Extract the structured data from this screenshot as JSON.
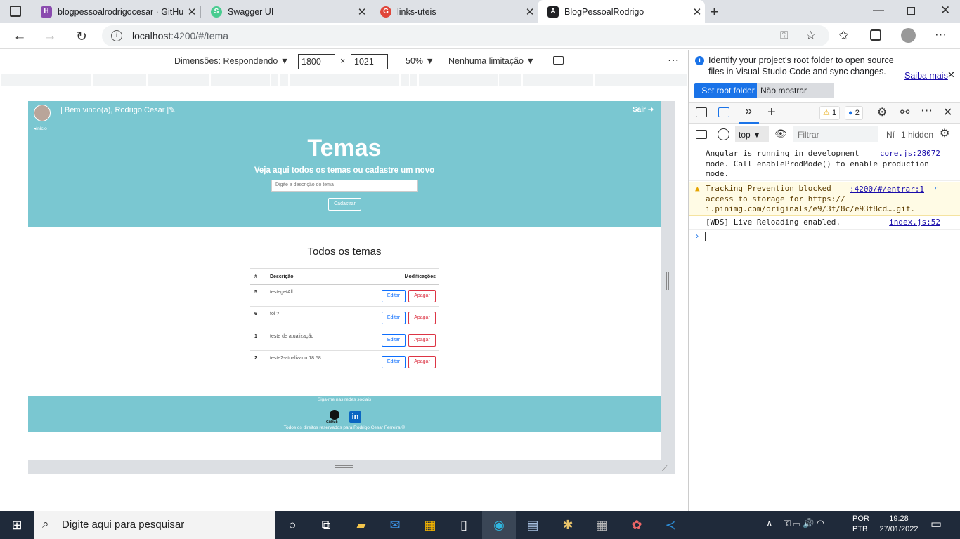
{
  "browser": {
    "tabs": [
      {
        "label": "blogpessoalrodrigocesar · GitHub",
        "icon": "H",
        "color": "#8a4baf",
        "active": false
      },
      {
        "label": "Swagger UI",
        "icon": "S",
        "color": "#49cc90",
        "active": false
      },
      {
        "label": "links-uteis",
        "icon": "G",
        "color": "#e0463a",
        "active": false
      },
      {
        "label": "BlogPessoalRodrigo",
        "icon": "A",
        "color": "#202124",
        "active": true
      }
    ],
    "url_host": "localhost",
    "url_path": ":4200/#/tema"
  },
  "devbar": {
    "dimensions": "Dimensões: Respondendo",
    "width": "1800",
    "height": "1021",
    "x": "×",
    "zoom": "50%",
    "throttle": "Nenhuma limitação"
  },
  "site": {
    "welcome": "| Bem vindo(a), Rodrigo Cesar |",
    "logout": "Sair",
    "home": "Início",
    "title": "Temas",
    "subtitle": "Veja aqui todos os temas ou cadastre um novo",
    "input_placeholder": "Digite a descrição do tema",
    "register_button": "Cadastrar",
    "list_title": "Todos os temas",
    "table": {
      "headers": {
        "num": "#",
        "desc": "Descrição",
        "mods": "Modificações"
      },
      "rows": [
        {
          "id": "5",
          "desc": "testegetAll"
        },
        {
          "id": "6",
          "desc": "foi ?"
        },
        {
          "id": "1",
          "desc": "teste de atualização"
        },
        {
          "id": "2",
          "desc": "teste2-atualizado 18:58"
        }
      ],
      "edit_label": "Editar",
      "delete_label": "Apagar"
    },
    "footer": {
      "follow": "Siga-me nas redes sociais",
      "github_label": "GitHub",
      "linkedin_label": "in",
      "copyright": "Todos os direitos reservados para Rodrigo Cesar Ferreira ©"
    }
  },
  "devtools": {
    "info_line1": "Identify your project's root folder to open source",
    "info_line2": "files in Visual Studio Code and sync changes.",
    "learn_more": "Saiba mais",
    "set_root": "Set root folder",
    "dont_show": "Não mostrar novamente",
    "warn_count": "1",
    "msg_count": "2",
    "context": "top",
    "filter_placeholder": "Filtrar",
    "levels": "Ní",
    "hidden": "1 hidden",
    "console": [
      {
        "lines": [
          "Angular is running in development",
          "mode. Call enableProdMode() to enable production",
          "mode."
        ],
        "source": "core.js:28072",
        "level": "info"
      },
      {
        "lines": [
          "Tracking Prevention blocked",
          "access to storage for https://",
          "i.pinimg.com/originals/e9/3f/8c/e93f8cd….gif."
        ],
        "source": ":4200/#/entrar:1",
        "level": "warning"
      },
      {
        "lines": [
          "[WDS] Live Reloading enabled."
        ],
        "source": "index.js:52",
        "level": "info"
      }
    ]
  },
  "taskbar": {
    "search_placeholder": "Digite aqui para pesquisar",
    "lang1": "POR",
    "lang2": "PTB",
    "time": "19:28",
    "date": "27/01/2022"
  }
}
